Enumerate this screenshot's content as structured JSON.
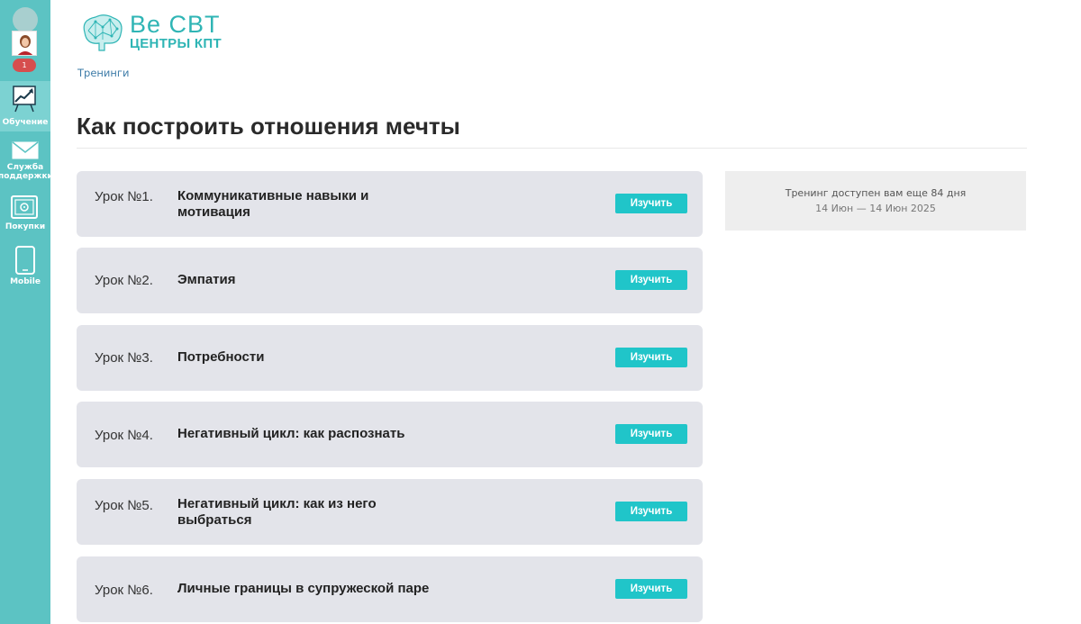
{
  "sidebar": {
    "notification_count": "1",
    "items": [
      {
        "label": "Обучение",
        "icon": "training-chart-icon"
      },
      {
        "label": "Служба поддержки",
        "icon": "mail-icon"
      },
      {
        "label": "Покупки",
        "icon": "safe-icon"
      },
      {
        "label": "Mobile",
        "icon": "mobile-phone-icon"
      }
    ]
  },
  "logo": {
    "line1": "Be CBT",
    "line2": "ЦЕНТРЫ КПТ",
    "brand_color": "#2fb5b5"
  },
  "breadcrumb": "Тренинги",
  "page_title": "Как построить отношения мечты",
  "lessons": [
    {
      "number": "Урок №1.",
      "title": "Коммуникативные навыки и мотивация",
      "button": "Изучить"
    },
    {
      "number": "Урок №2.",
      "title": "Эмпатия",
      "button": "Изучить"
    },
    {
      "number": "Урок №3.",
      "title": "Потребности",
      "button": "Изучить"
    },
    {
      "number": "Урок №4.",
      "title": "Негативный цикл: как распознать",
      "button": "Изучить"
    },
    {
      "number": "Урок №5.",
      "title": "Негативный цикл: как из него выбраться",
      "button": "Изучить"
    },
    {
      "number": "Урок №6.",
      "title": "Личные границы в супружеской паре",
      "button": "Изучить"
    }
  ],
  "access_info": {
    "line1": "Тренинг доступен вам еще 84 дня",
    "line2": "14 Июн — 14 Июн 2025"
  },
  "colors": {
    "sidebar": "#5cc3c3",
    "accent_button": "#20c5c9",
    "lesson_card": "#e3e4ea"
  }
}
